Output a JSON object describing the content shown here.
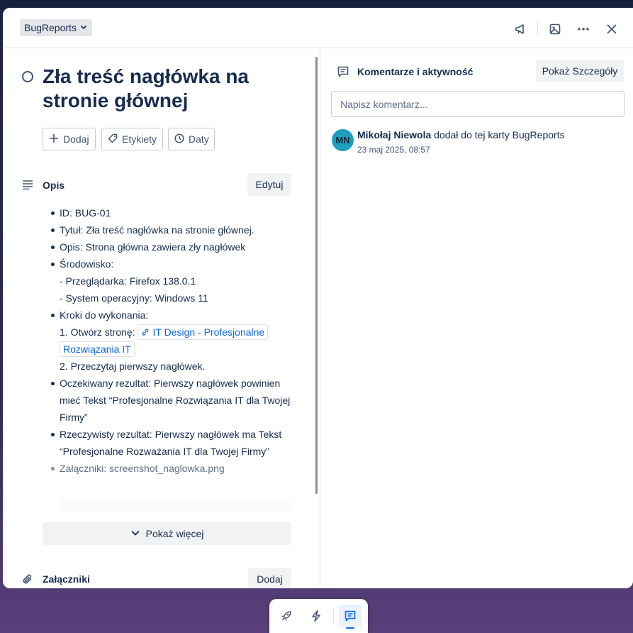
{
  "header": {
    "list_name": "BugReports"
  },
  "card": {
    "title": "Zła treść nagłówka na stronie głównej",
    "actions": {
      "add": "Dodaj",
      "labels": "Etykiety",
      "dates": "Daty"
    }
  },
  "description": {
    "heading": "Opis",
    "edit_label": "Edytuj",
    "lines": {
      "id": "ID: BUG-01",
      "title": "Tytuł: Zła treść nagłówka na stronie głównej.",
      "desc": "Opis: Strona główna zawiera zły nagłówek",
      "env": "Środowisko:",
      "env_browser": "- Przeglądarka: Firefox 138.0.1",
      "env_os": "- System operacyjny: Windows 11",
      "steps": "Kroki do wykonania:",
      "step1_prefix": "1. Otwórz stronę:",
      "step1_link": "IT Design - Profesjonalne Rozwiązania IT",
      "step2": "2. Przeczytaj pierwszy nagłówek.",
      "expected": "Oczekiwany rezultat: Pierwszy nagłówek powinien mieć Tekst “Profesjonalne Rozwiązania IT dla Twojej Firmy”",
      "actual": "Rzeczywisty rezultat: Pierwszy nagłówek ma Tekst “Profesjonalne Rozważania IT dla Twojej Firmy”",
      "attachments": "Załączniki: screenshot_naglowka.png"
    },
    "show_more": "Pokaż więcej"
  },
  "attachments": {
    "heading": "Załączniki",
    "add_label": "Dodaj"
  },
  "activity": {
    "heading": "Komentarze i aktywność",
    "details_button": "Pokaż Szczegóły",
    "comment_placeholder": "Napisz komentarz...",
    "entries": [
      {
        "initials": "MN",
        "user": "Mikołaj Niewola",
        "action": "dodał do tej karty BugReports",
        "time": "23 maj 2025, 08:57"
      }
    ]
  },
  "colors": {
    "accent": "#0c66e4",
    "avatar": "#1d9fbd",
    "dock_active": "#0c66e4"
  }
}
